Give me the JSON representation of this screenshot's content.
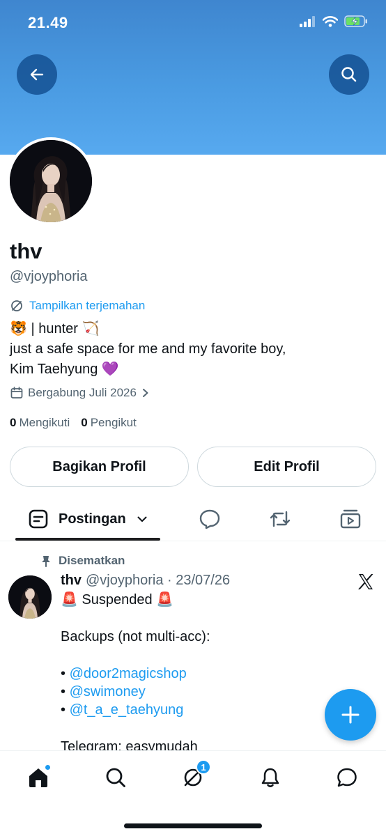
{
  "status_bar": {
    "time": "21.49"
  },
  "profile": {
    "display_name": "thv",
    "handle": "@vjoyphoria",
    "translate_label": "Tampilkan terjemahan",
    "bio_lines": [
      "🐯 | hunter 🏹",
      "just a safe space for me and my favorite boy,",
      "Kim Taehyung 💜"
    ],
    "joined": "Bergabung Juli 2026",
    "following_count": "0",
    "following_label": "Mengikuti",
    "followers_count": "0",
    "followers_label": "Pengikut"
  },
  "actions": {
    "share_label": "Bagikan Profil",
    "edit_label": "Edit Profil"
  },
  "tabs": {
    "posts_label": "Postingan",
    "icons": [
      "reply-icon",
      "repost-icon",
      "media-icon"
    ]
  },
  "pinned_post": {
    "pinned_label": "Disematkan",
    "name": "thv",
    "meta": "@vjoyphoria · 23/07/26",
    "lines": [
      "🚨 Suspended 🚨",
      "",
      "Backups (not multi-acc):",
      "",
      "• ",
      "• ",
      "• ",
      "",
      "Telegram: easymudah"
    ],
    "mentions": [
      "@door2magicshop",
      "@swimoney",
      "@t_a_e_taehyung"
    ]
  },
  "bottom_nav": {
    "items": [
      "home-icon",
      "search-icon",
      "grok-icon",
      "bell-icon",
      "messages-icon"
    ],
    "grok_badge": "1"
  },
  "colors": {
    "accent": "#1d9bf0",
    "banner": "#4a9be2",
    "text": "#0f1419",
    "muted": "#536471"
  }
}
